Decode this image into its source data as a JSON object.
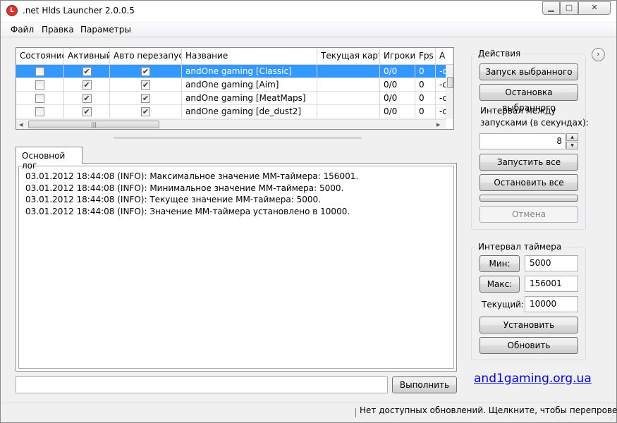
{
  "window": {
    "title": ".net Hlds Launcher 2.0.0.5",
    "icon_letter": "L"
  },
  "menu": [
    "Файл",
    "Правка",
    "Параметры"
  ],
  "grid": {
    "columns": [
      "Состояние",
      "Активный",
      "Авто перезапуск",
      "Название",
      "Текущая карта",
      "Игроки",
      "Fps",
      "A"
    ],
    "rows": [
      {
        "state": false,
        "active": true,
        "auto_restart": true,
        "name": "andOne gaming [Classic]",
        "map": "",
        "players": "0/0",
        "fps": "0",
        "extra": "-c",
        "selected": true
      },
      {
        "state": false,
        "active": true,
        "auto_restart": true,
        "name": "andOne gaming [Aim]",
        "map": "",
        "players": "0/0",
        "fps": "0",
        "extra": "-c",
        "selected": false
      },
      {
        "state": false,
        "active": true,
        "auto_restart": true,
        "name": "andOne gaming [MeatMaps]",
        "map": "",
        "players": "0/0",
        "fps": "0",
        "extra": "-c",
        "selected": false
      },
      {
        "state": false,
        "active": true,
        "auto_restart": true,
        "name": "andOne gaming [de_dust2]",
        "map": "",
        "players": "0/0",
        "fps": "0",
        "extra": "-c",
        "selected": false
      }
    ]
  },
  "log": {
    "tab_label": "Основной лог",
    "lines": [
      "03.01.2012 18:44:08 (INFO): Максимальное значение MM-таймера: 156001.",
      "03.01.2012 18:44:08 (INFO): Минимальное значение MM-таймера: 5000.",
      "03.01.2012 18:44:08 (INFO): Текущее значение MM-таймера: 5000.",
      "03.01.2012 18:44:08 (INFO): Значение MM-таймера установлено в 10000."
    ]
  },
  "command": {
    "input_value": "",
    "execute_label": "Выполнить"
  },
  "actions": {
    "title": "Действия",
    "start_selected": "Запуск выбранного",
    "stop_selected": "Остановка выбранного",
    "interval_label_1": "Интервал между",
    "interval_label_2": "запусками (в секундах):",
    "interval_value": "8",
    "start_all": "Запустить все",
    "stop_all": "Остановить все",
    "cancel": "Отмена"
  },
  "timer": {
    "title": "Интервал таймера",
    "min_label": "Мин:",
    "min_value": "5000",
    "max_label": "Макс:",
    "max_value": "156001",
    "current_label": "Текущий:",
    "current_value": "10000",
    "set_label": "Установить",
    "refresh_label": "Обновить"
  },
  "link": "and1gaming.org.ua",
  "status": "Нет доступных обновлений. Щелкните, чтобы перепроверить..."
}
